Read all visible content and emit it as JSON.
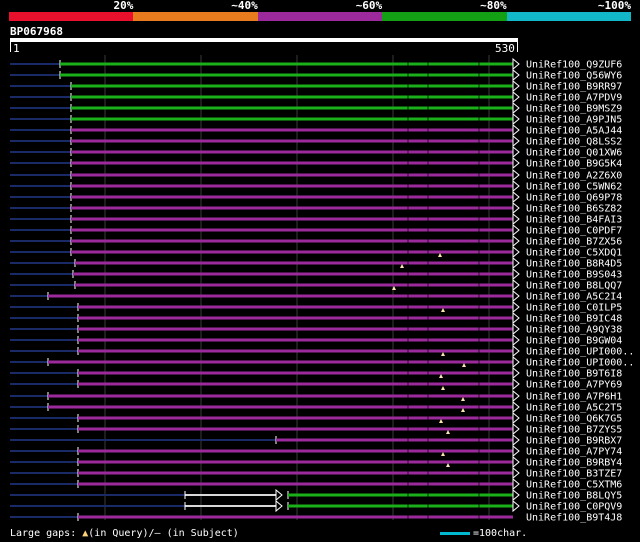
{
  "legend": {
    "labels": [
      "20%",
      "~40%",
      "~60%",
      "~80%",
      "~100%"
    ],
    "colors": [
      "#e8102d",
      "#e87b1e",
      "#9c2a9c",
      "#14a014",
      "#12b8c8"
    ]
  },
  "query": {
    "name": "BP067968",
    "start": "1",
    "end": "530",
    "length": 530
  },
  "hits": [
    {
      "label": "UniRef100_Q9ZUF6",
      "color": "#1ab01a",
      "start": 60,
      "marks": [],
      "end": "arrow"
    },
    {
      "label": "UniRef100_Q56WY6",
      "color": "#1ab01a",
      "start": 60,
      "marks": [],
      "end": "arrow"
    },
    {
      "label": "UniRef100_B9RR97",
      "color": "#1ab01a",
      "start": 71,
      "marks": [],
      "end": "arrow"
    },
    {
      "label": "UniRef100_A7PDV9",
      "color": "#1ab01a",
      "start": 71,
      "marks": [],
      "end": "arrow"
    },
    {
      "label": "UniRef100_B9MSZ9",
      "color": "#1ab01a",
      "start": 71,
      "marks": [],
      "end": "arrow"
    },
    {
      "label": "UniRef100_A9PJN5",
      "color": "#1ab01a",
      "start": 71,
      "marks": [],
      "end": "arrow"
    },
    {
      "label": "UniRef100_A5AJ44",
      "color": "#9c2a9c",
      "start": 71,
      "marks": [],
      "end": "arrow"
    },
    {
      "label": "UniRef100_Q8LSS2",
      "color": "#9c2a9c",
      "start": 71,
      "marks": [],
      "end": "arrow"
    },
    {
      "label": "UniRef100_Q01XW6",
      "color": "#9c2a9c",
      "start": 71,
      "marks": [],
      "end": "arrow"
    },
    {
      "label": "UniRef100_B9G5K4",
      "color": "#9c2a9c",
      "start": 71,
      "marks": [],
      "end": "arrow"
    },
    {
      "label": "UniRef100_A2Z6X0",
      "color": "#9c2a9c",
      "start": 71,
      "marks": [],
      "end": "arrow"
    },
    {
      "label": "UniRef100_C5WN62",
      "color": "#9c2a9c",
      "start": 71,
      "marks": [],
      "end": "arrow"
    },
    {
      "label": "UniRef100_Q69P78",
      "color": "#9c2a9c",
      "start": 71,
      "marks": [],
      "end": "arrow"
    },
    {
      "label": "UniRef100_B6SZ82",
      "color": "#9c2a9c",
      "start": 71,
      "marks": [],
      "end": "arrow"
    },
    {
      "label": "UniRef100_B4FAI3",
      "color": "#9c2a9c",
      "start": 71,
      "marks": [],
      "end": "arrow"
    },
    {
      "label": "UniRef100_C0PDF7",
      "color": "#9c2a9c",
      "start": 71,
      "marks": [],
      "end": "arrow"
    },
    {
      "label": "UniRef100_B7ZX56",
      "color": "#9c2a9c",
      "start": 71,
      "marks": [],
      "end": "arrow"
    },
    {
      "label": "UniRef100_C5XDQ1",
      "color": "#9c2a9c",
      "start": 71,
      "marks": [],
      "end": "arrow"
    },
    {
      "label": "UniRef100_B8R4D5",
      "color": "#9c2a9c",
      "start": 75,
      "marks": [
        440
      ],
      "end": "arrow"
    },
    {
      "label": "UniRef100_B9S043",
      "color": "#9c2a9c",
      "start": 73,
      "marks": [
        402
      ],
      "end": "arrow"
    },
    {
      "label": "UniRef100_B8LQQ7",
      "color": "#9c2a9c",
      "start": 75,
      "marks": [],
      "end": "arrow"
    },
    {
      "label": "UniRef100_A5C2I4",
      "color": "#9c2a9c",
      "start": 48,
      "marks": [
        394
      ],
      "end": "arrow"
    },
    {
      "label": "UniRef100_C0ILP5",
      "color": "#9c2a9c",
      "start": 78,
      "marks": [],
      "end": "arrow"
    },
    {
      "label": "UniRef100_B9IC48",
      "color": "#9c2a9c",
      "start": 78,
      "marks": [
        443
      ],
      "end": "arrow"
    },
    {
      "label": "UniRef100_A9QY38",
      "color": "#9c2a9c",
      "start": 78,
      "marks": [],
      "end": "arrow"
    },
    {
      "label": "UniRef100_B9GW04",
      "color": "#9c2a9c",
      "start": 78,
      "marks": [],
      "end": "arrow"
    },
    {
      "label": "UniRef100_UPI000..",
      "color": "#9c2a9c",
      "start": 78,
      "marks": [],
      "end": "arrow"
    },
    {
      "label": "UniRef100_UPI000..",
      "color": "#9c2a9c",
      "start": 48,
      "marks": [
        443
      ],
      "end": "arrow"
    },
    {
      "label": "UniRef100_B9T6I8",
      "color": "#9c2a9c",
      "start": 78,
      "marks": [
        464
      ],
      "end": "arrow"
    },
    {
      "label": "UniRef100_A7PY69",
      "color": "#9c2a9c",
      "start": 78,
      "marks": [
        441
      ],
      "end": "arrow"
    },
    {
      "label": "UniRef100_A7P6H1",
      "color": "#9c2a9c",
      "start": 48,
      "marks": [
        443
      ],
      "end": "arrow"
    },
    {
      "label": "UniRef100_A5C2T5",
      "color": "#9c2a9c",
      "start": 48,
      "marks": [
        463
      ],
      "end": "arrow"
    },
    {
      "label": "UniRef100_Q6K7G5",
      "color": "#9c2a9c",
      "start": 78,
      "marks": [
        463
      ],
      "end": "arrow"
    },
    {
      "label": "UniRef100_B7ZYS5",
      "color": "#9c2a9c",
      "start": 78,
      "marks": [
        441
      ],
      "end": "arrow"
    },
    {
      "label": "UniRef100_B9RBX7",
      "color": "#9c2a9c",
      "start": 276,
      "marks": [
        448
      ],
      "end": "arrow"
    },
    {
      "label": "UniRef100_A7PY74",
      "color": "#9c2a9c",
      "start": 78,
      "marks": [],
      "end": "arrow"
    },
    {
      "label": "UniRef100_B9RBY4",
      "color": "#9c2a9c",
      "start": 78,
      "marks": [
        443
      ],
      "end": "arrow"
    },
    {
      "label": "UniRef100_B3TZE7",
      "color": "#9c2a9c",
      "start": 78,
      "marks": [
        448
      ],
      "end": "arrow"
    },
    {
      "label": "UniRef100_C5XTM6",
      "color": "#9c2a9c",
      "start": 78,
      "marks": [],
      "end": "arrow"
    },
    {
      "label": "UniRef100_B8LQY5",
      "color": "#1ab01a",
      "start": 288,
      "prefix": [
        185,
        276
      ],
      "marks": [],
      "end": "arrow"
    },
    {
      "label": "UniRef100_C0PQV9",
      "color": "#1ab01a",
      "start": 288,
      "prefix": [
        185,
        276
      ],
      "marks": [],
      "end": "arrow"
    },
    {
      "label": "UniRef100_B9T4J8",
      "color": "#9c2a9c",
      "start": 78,
      "marks": [],
      "end": "none"
    }
  ],
  "footer": {
    "gaps_label": "Large gaps: ",
    "in_query": "(in Query)/",
    "dash": "–",
    "in_subject": " (in Subject)",
    "scale_label": "=100char."
  }
}
